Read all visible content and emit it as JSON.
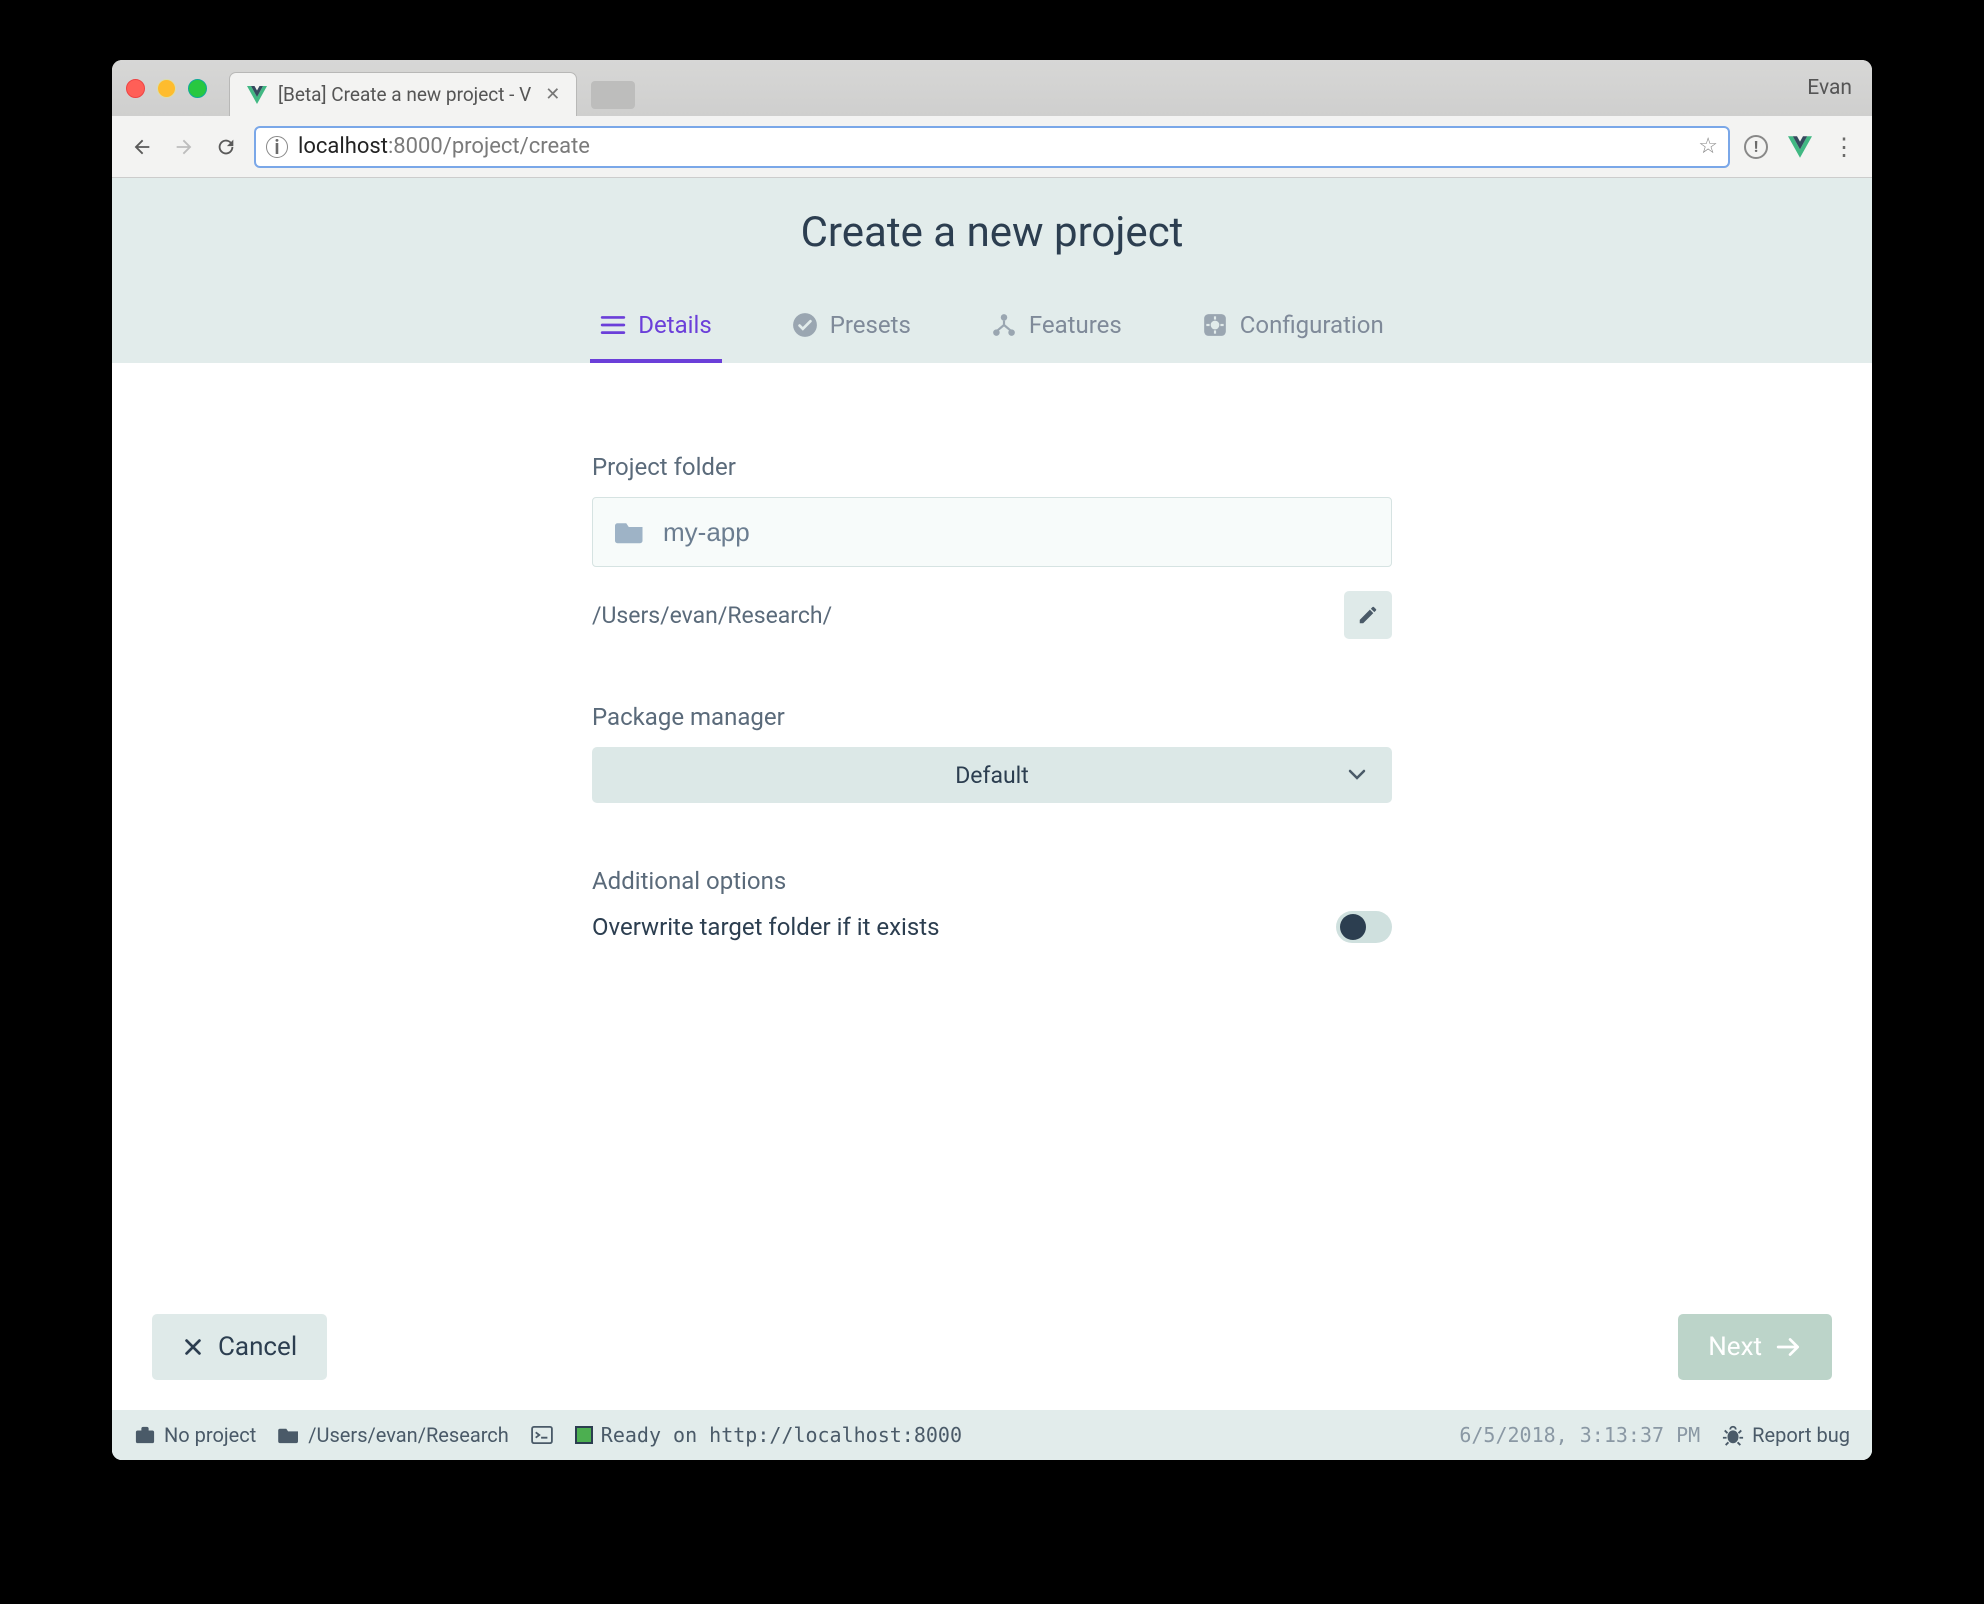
{
  "browser": {
    "tab_title": "[Beta] Create a new project - V",
    "profile": "Evan",
    "url_host": "localhost",
    "url_port": ":8000",
    "url_path": "/project/create"
  },
  "page": {
    "title": "Create a new project",
    "steps": {
      "details": "Details",
      "presets": "Presets",
      "features": "Features",
      "configuration": "Configuration"
    },
    "form": {
      "project_folder_label": "Project folder",
      "project_folder_value": "my-app",
      "project_path": "/Users/evan/Research/",
      "package_manager_label": "Package manager",
      "package_manager_value": "Default",
      "additional_options_label": "Additional options",
      "overwrite_label": "Overwrite target folder if it exists",
      "overwrite_value": false
    },
    "actions": {
      "cancel": "Cancel",
      "next": "Next"
    }
  },
  "statusbar": {
    "project": "No project",
    "cwd": "/Users/evan/Research",
    "ready": "Ready on http://localhost:8000",
    "timestamp": "6/5/2018, 3:13:37 PM",
    "report_bug": "Report bug"
  }
}
